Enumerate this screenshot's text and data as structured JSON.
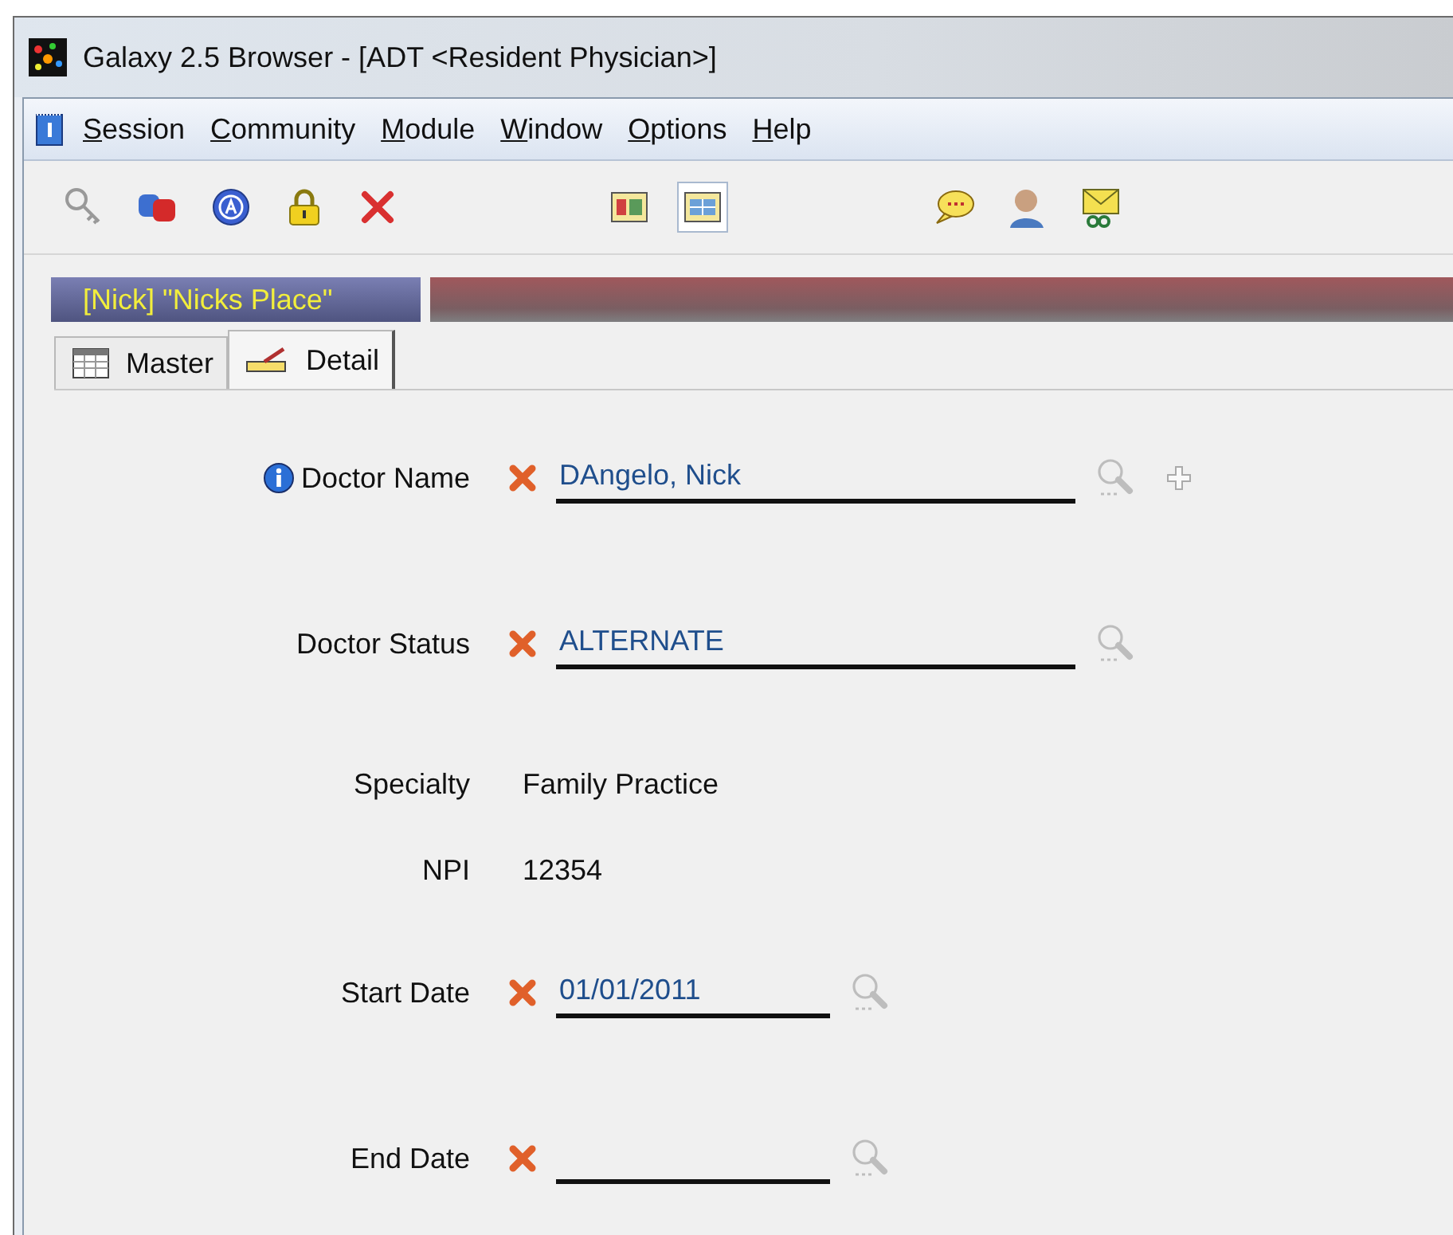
{
  "window": {
    "title": "Galaxy 2.5 Browser - [ADT  <Resident Physician>]"
  },
  "menu": [
    "Session",
    "Community",
    "Module",
    "Window",
    "Options",
    "Help"
  ],
  "toolbar": [
    {
      "buttons": [
        {
          "kind": "key",
          "selected": false
        },
        {
          "kind": "database",
          "selected": false
        },
        {
          "kind": "letter",
          "selected": false
        },
        {
          "kind": "lock",
          "selected": false
        },
        {
          "kind": "delete",
          "selected": false
        }
      ]
    },
    {
      "buttons": [
        {
          "kind": "form",
          "selected": false
        },
        {
          "kind": "grid",
          "selected": true
        }
      ]
    },
    {
      "buttons": [
        {
          "kind": "chat",
          "selected": false
        },
        {
          "kind": "person",
          "selected": false
        },
        {
          "kind": "mail",
          "selected": false
        }
      ]
    }
  ],
  "context": {
    "label": "[Nick] \"Nicks Place\""
  },
  "tabs": [
    {
      "label": "Master",
      "kind": "grid",
      "selected": false
    },
    {
      "label": "Detail",
      "kind": "pencil",
      "selected": true
    }
  ],
  "fields": [
    {
      "kind": "lookup",
      "label": "Doctor Name",
      "value": "DAngelo, Nick",
      "required": true,
      "info": true,
      "add": true
    },
    {
      "kind": "lookup",
      "label": "Doctor Status",
      "value": "ALTERNATE",
      "required": true,
      "info": false,
      "add": false
    },
    {
      "kind": "static",
      "label": "Specialty",
      "value": "Family Practice"
    },
    {
      "kind": "static",
      "label": "NPI",
      "value": "12354"
    },
    {
      "kind": "date",
      "label": "Start Date",
      "value": "01/01/2011",
      "required": true,
      "info": false,
      "add": false
    },
    {
      "kind": "date",
      "label": "End Date",
      "required": true,
      "info": false,
      "add": false
    }
  ]
}
